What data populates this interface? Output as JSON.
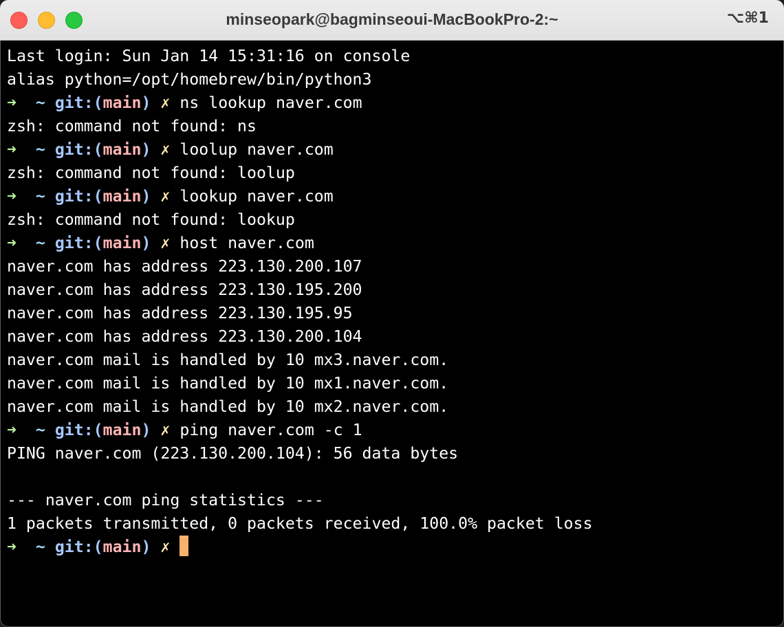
{
  "window": {
    "title": "minseopark@bagminseoui-MacBookPro-2:~",
    "shortcut": "⌥⌘1"
  },
  "prompt": {
    "arrow": "➜",
    "dir": "~",
    "git_prefix": "git:(",
    "branch": "main",
    "git_suffix": ")",
    "dirty_mark": "✗"
  },
  "terminal": {
    "lines": [
      {
        "type": "output",
        "text": "Last login: Sun Jan 14 15:31:16 on console"
      },
      {
        "type": "output",
        "text": "alias python=/opt/homebrew/bin/python3"
      },
      {
        "type": "prompt",
        "command": "ns lookup naver.com"
      },
      {
        "type": "output",
        "text": "zsh: command not found: ns"
      },
      {
        "type": "prompt",
        "command": "loolup naver.com"
      },
      {
        "type": "output",
        "text": "zsh: command not found: loolup"
      },
      {
        "type": "prompt",
        "command": "lookup naver.com"
      },
      {
        "type": "output",
        "text": "zsh: command not found: lookup"
      },
      {
        "type": "prompt",
        "command": "host naver.com"
      },
      {
        "type": "output",
        "text": "naver.com has address 223.130.200.107"
      },
      {
        "type": "output",
        "text": "naver.com has address 223.130.195.200"
      },
      {
        "type": "output",
        "text": "naver.com has address 223.130.195.95"
      },
      {
        "type": "output",
        "text": "naver.com has address 223.130.200.104"
      },
      {
        "type": "output",
        "text": "naver.com mail is handled by 10 mx3.naver.com."
      },
      {
        "type": "output",
        "text": "naver.com mail is handled by 10 mx1.naver.com."
      },
      {
        "type": "output",
        "text": "naver.com mail is handled by 10 mx2.naver.com."
      },
      {
        "type": "prompt",
        "command": "ping naver.com -c 1"
      },
      {
        "type": "output",
        "text": "PING naver.com (223.130.200.104): 56 data bytes"
      },
      {
        "type": "output",
        "text": ""
      },
      {
        "type": "output",
        "text": "--- naver.com ping statistics ---"
      },
      {
        "type": "output",
        "text": "1 packets transmitted, 0 packets received, 100.0% packet loss"
      },
      {
        "type": "prompt",
        "command": "",
        "cursor": true
      }
    ]
  },
  "colors": {
    "terminal_bg": "#000000",
    "text": "#ffffff",
    "arrow": "#b8f49e",
    "git": "#a6c8ff",
    "branch": "#ffb3b3",
    "cursor": "#f6b06f"
  }
}
